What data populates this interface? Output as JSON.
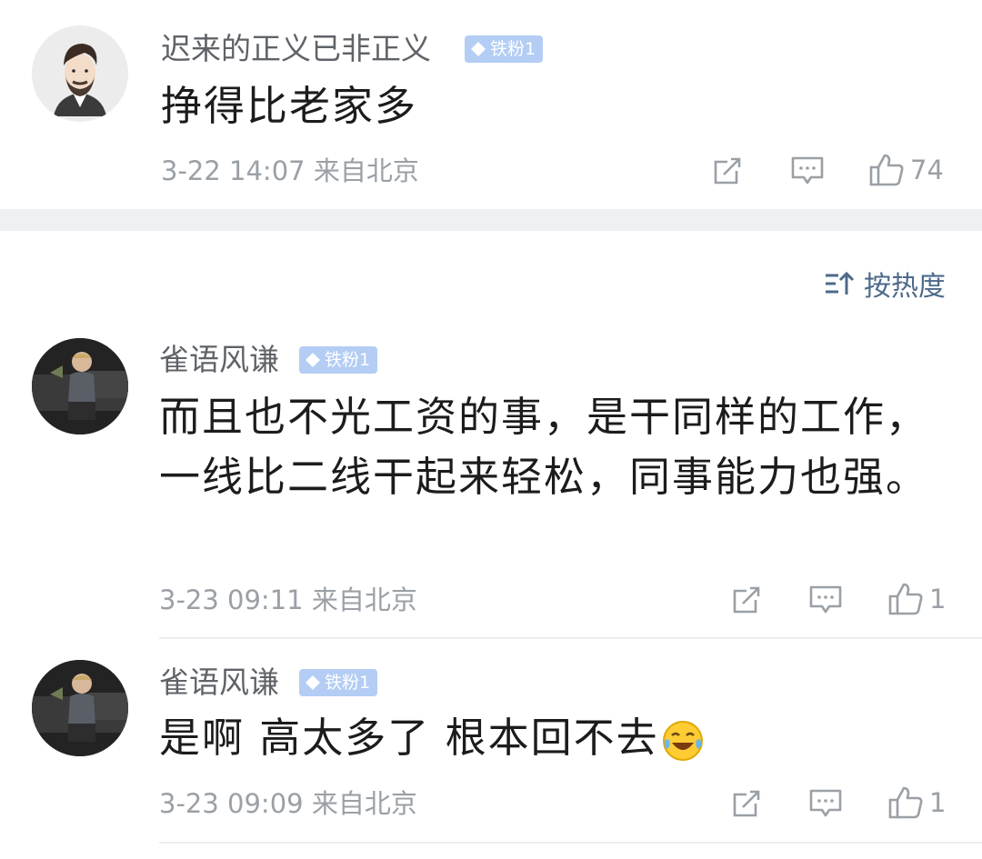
{
  "comments": [
    {
      "username": "迟来的正义已非正义",
      "badge": "铁粉1",
      "text": "挣得比老家多",
      "meta": "3-22 14:07 来自北京",
      "likes": "74",
      "avatar_icon": "bearded-man-avatar"
    },
    {
      "username": "雀语风谦",
      "badge": "铁粉1",
      "text": "而且也不光工资的事，是干同样的工作，一线比二线干起来轻松，同事能力也强。",
      "meta": "3-23 09:11 来自北京",
      "likes": "1",
      "avatar_icon": "child-photo-avatar"
    },
    {
      "username": "雀语风谦",
      "badge": "铁粉1",
      "text": "是啊 高太多了 根本回不去",
      "meta": "3-23 09:09 来自北京",
      "likes": "1",
      "avatar_icon": "child-photo-avatar",
      "emoji": "laugh-cry-emoji"
    }
  ],
  "sort": {
    "label": "按热度",
    "icon": "sort-icon"
  },
  "colors": {
    "badge_bg": "#b3cdf4",
    "text": "#1c1c1c",
    "meta": "#9aa0a6",
    "username": "#5f6368",
    "sort_text": "#4d6a8a",
    "divider": "#eef0f2"
  }
}
